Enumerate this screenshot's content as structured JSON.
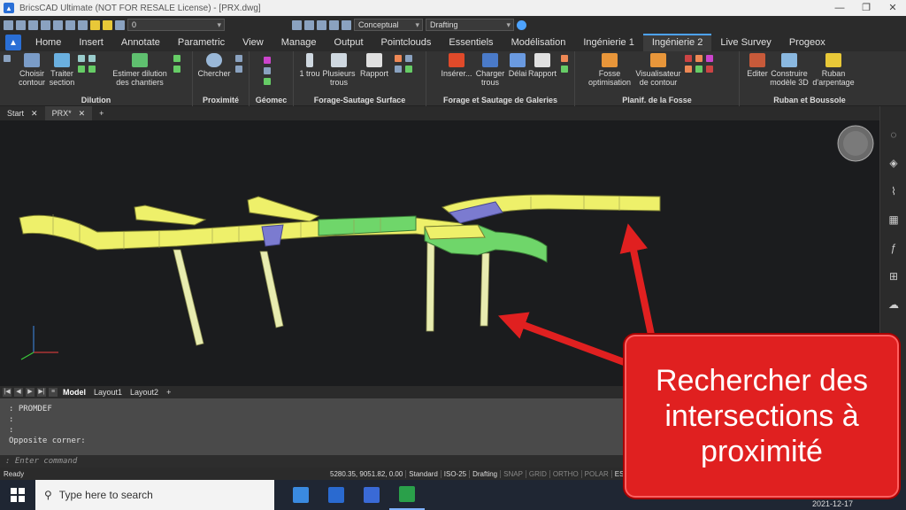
{
  "window": {
    "title": "BricsCAD Ultimate (NOT FOR RESALE License) - [PRX.dwg]",
    "controls": [
      "—",
      "❐",
      "✕"
    ]
  },
  "qat": {
    "layer_value": "0",
    "visual_style": "Conceptual",
    "workspace": "Drafting"
  },
  "ribbon_tabs": [
    "Home",
    "Insert",
    "Annotate",
    "Parametric",
    "View",
    "Manage",
    "Output",
    "Pointclouds",
    "Essentiels",
    "Modélisation",
    "Ingénierie 1",
    "Ingénierie 2",
    "Live Survey",
    "Progeox"
  ],
  "ribbon_active_tab": "Ingénierie 2",
  "ribbon_groups": [
    {
      "title": "Dilution",
      "buttons": [
        "Choisir contour",
        "Traiter section",
        "Estimer dilution des chantiers"
      ]
    },
    {
      "title": "Proximité",
      "buttons": [
        "Chercher"
      ]
    },
    {
      "title": "Géomec",
      "buttons": []
    },
    {
      "title": "Forage-Sautage Surface",
      "buttons": [
        "1 trou",
        "Plusieurs trous",
        "Rapport"
      ]
    },
    {
      "title": "Forage et Sautage de Galeries",
      "buttons": [
        "Insérer...",
        "Charger trous",
        "Délai",
        "Rapport"
      ]
    },
    {
      "title": "Planif. de la Fosse",
      "buttons": [
        "Fosse optimisation",
        "Visualisateur de contour"
      ]
    },
    {
      "title": "Ruban et Boussole",
      "buttons": [
        "Editer",
        "Construire modèle 3D",
        "Ruban d'arpentage"
      ]
    }
  ],
  "doc_tabs": [
    {
      "label": "Start",
      "close": "✕"
    },
    {
      "label": "PRX*",
      "close": "✕"
    },
    {
      "label": "+",
      "close": ""
    }
  ],
  "layout_tabs": [
    "Model",
    "Layout1",
    "Layout2",
    "+"
  ],
  "command_history": [
    ": PROMDEF",
    ":",
    ":",
    "Opposite corner:"
  ],
  "command_prompt": ": Enter command",
  "status": {
    "ready": "Ready",
    "coords": "5280.35, 9051.82, 0.00",
    "items": [
      "Standard",
      "ISO-25",
      "Drafting",
      "SNAP",
      "GRID",
      "ORTHO",
      "POLAR",
      "ES"
    ]
  },
  "taskbar": {
    "search_placeholder": "Type here to search",
    "clock": "2021-12-17"
  },
  "callout": {
    "text": "Rechercher des intersections à proximité",
    "color": "#e02020"
  },
  "colors": {
    "tunnel_yellow": "#eef06a",
    "tunnel_green": "#6fd66a",
    "tunnel_purple": "#7b7bd0",
    "accent": "#4da3ff"
  }
}
